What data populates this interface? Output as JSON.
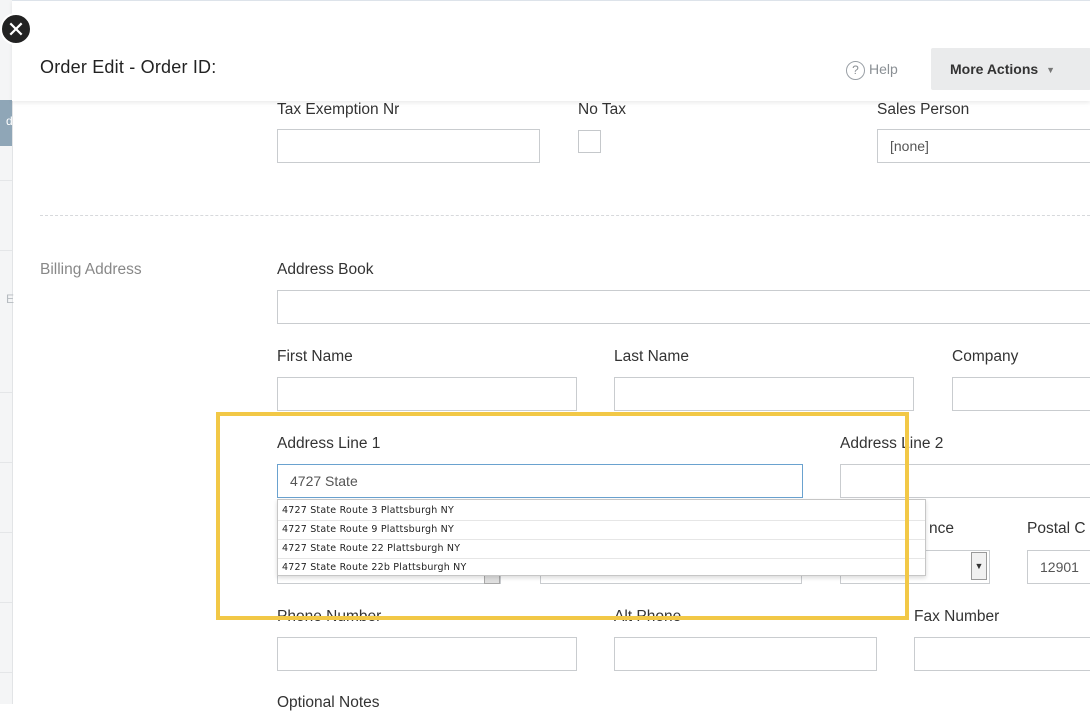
{
  "modal": {
    "title": "Order Edit - Order ID:",
    "close_icon": "close-icon",
    "help_label": "Help",
    "help_icon": "question-circle-icon",
    "more_actions_label": "More Actions",
    "more_actions_icon": "chevron-down-icon"
  },
  "backdrop": {
    "edge_char_1": "de",
    "edge_char_2": "E"
  },
  "tax": {
    "exemption_label": "Tax Exemption Nr",
    "exemption_value": "",
    "no_tax_label": "No Tax",
    "no_tax_checked": false,
    "sales_person_label": "Sales Person",
    "sales_person_value": "[none]"
  },
  "billing": {
    "section_label": "Billing Address",
    "address_book_label": "Address Book",
    "address_book_value": "",
    "first_name_label": "First Name",
    "first_name_value": "",
    "last_name_label": "Last Name",
    "last_name_value": "",
    "company_label": "Company",
    "company_value": "",
    "address1_label": "Address Line 1",
    "address1_value": "4727 State",
    "address2_label": "Address Line 2",
    "address2_value": "",
    "province_label_partial": "nce",
    "postal_label_partial": "Postal C",
    "postal_value": "12901",
    "phone_label": "Phone Number",
    "phone_value": "",
    "alt_phone_label": "Alt Phone",
    "alt_phone_value": "",
    "fax_label": "Fax Number",
    "fax_value": "",
    "notes_label": "Optional Notes"
  },
  "autocomplete": {
    "items": [
      "4727 State Route 3 Plattsburgh NY",
      "4727 State Route 9 Plattsburgh NY",
      "4727 State Route 22 Plattsburgh NY",
      "4727 State Route 22b Plattsburgh NY"
    ]
  },
  "colors": {
    "highlight": "#f2c846",
    "focus_border": "#6aa2cf",
    "backdrop_tab": "#8fa6b7"
  }
}
